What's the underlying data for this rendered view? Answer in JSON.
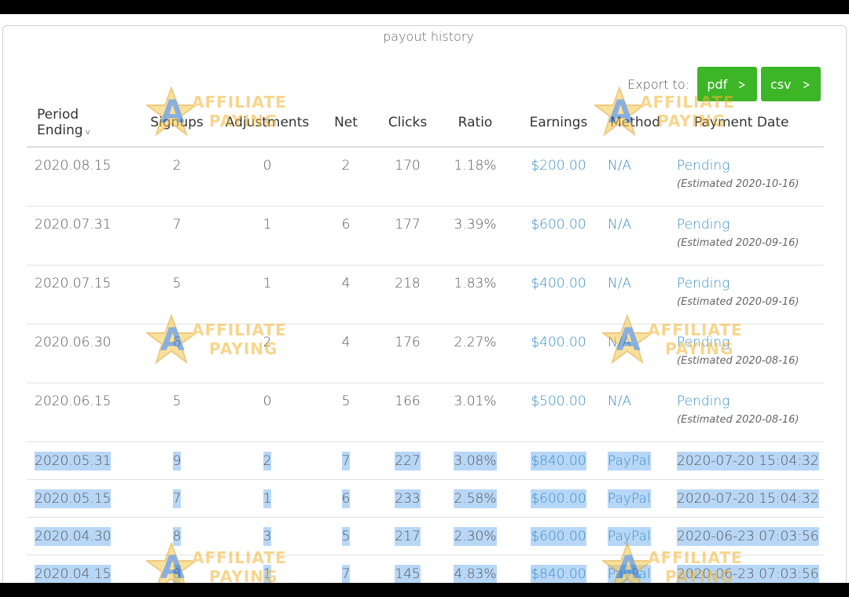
{
  "panel": {
    "title": "payout history"
  },
  "export": {
    "label": "Export to:",
    "buttons": [
      "pdf",
      "csv"
    ]
  },
  "table": {
    "headers": [
      "Period Ending",
      "Signups",
      "Adjustments",
      "Net",
      "Clicks",
      "Ratio",
      "Earnings",
      "Method",
      "Payment Date"
    ],
    "sort_indicator": "v",
    "rows": [
      {
        "period": "2020.08.15",
        "signups": "2",
        "adjustments": "0",
        "net": "2",
        "clicks": "170",
        "ratio": "1.18%",
        "earnings": "$200.00",
        "method": "N/A",
        "payment": "Pending",
        "estimated": "(Estimated 2020-10-16)",
        "status": "pending"
      },
      {
        "period": "2020.07.31",
        "signups": "7",
        "adjustments": "1",
        "net": "6",
        "clicks": "177",
        "ratio": "3.39%",
        "earnings": "$600.00",
        "method": "N/A",
        "payment": "Pending",
        "estimated": "(Estimated 2020-09-16)",
        "status": "pending"
      },
      {
        "period": "2020.07.15",
        "signups": "5",
        "adjustments": "1",
        "net": "4",
        "clicks": "218",
        "ratio": "1.83%",
        "earnings": "$400.00",
        "method": "N/A",
        "payment": "Pending",
        "estimated": "(Estimated 2020-09-16)",
        "status": "pending"
      },
      {
        "period": "2020.06.30",
        "signups": "6",
        "adjustments": "2",
        "net": "4",
        "clicks": "176",
        "ratio": "2.27%",
        "earnings": "$400.00",
        "method": "N/A",
        "payment": "Pending",
        "estimated": "(Estimated 2020-08-16)",
        "status": "pending"
      },
      {
        "period": "2020.06.15",
        "signups": "5",
        "adjustments": "0",
        "net": "5",
        "clicks": "166",
        "ratio": "3.01%",
        "earnings": "$500.00",
        "method": "N/A",
        "payment": "Pending",
        "estimated": "(Estimated 2020-08-16)",
        "status": "pending"
      },
      {
        "period": "2020.05.31",
        "signups": "9",
        "adjustments": "2",
        "net": "7",
        "clicks": "227",
        "ratio": "3.08%",
        "earnings": "$840.00",
        "method": "PayPal",
        "payment": "2020-07-20 15:04:32",
        "estimated": "",
        "status": "paid"
      },
      {
        "period": "2020.05.15",
        "signups": "7",
        "adjustments": "1",
        "net": "6",
        "clicks": "233",
        "ratio": "2.58%",
        "earnings": "$600.00",
        "method": "PayPal",
        "payment": "2020-07-20 15:04:32",
        "estimated": "",
        "status": "paid"
      },
      {
        "period": "2020.04.30",
        "signups": "8",
        "adjustments": "3",
        "net": "5",
        "clicks": "217",
        "ratio": "2.30%",
        "earnings": "$600.00",
        "method": "PayPal",
        "payment": "2020-06-23 07:03:56",
        "estimated": "",
        "status": "paid"
      },
      {
        "period": "2020.04.15",
        "signups": "8",
        "adjustments": "1",
        "net": "7",
        "clicks": "145",
        "ratio": "4.83%",
        "earnings": "$840.00",
        "method": "PayPal",
        "payment": "2020-06-23 07:03:56",
        "estimated": "",
        "status": "paid"
      }
    ]
  },
  "watermark": {
    "line1": "AFFILIATE",
    "line2": "PAYING",
    "letter": "A"
  },
  "colors": {
    "accent_green": "#3cb526",
    "link_blue": "#3d8fc8",
    "selection": "#b8d7f7"
  }
}
